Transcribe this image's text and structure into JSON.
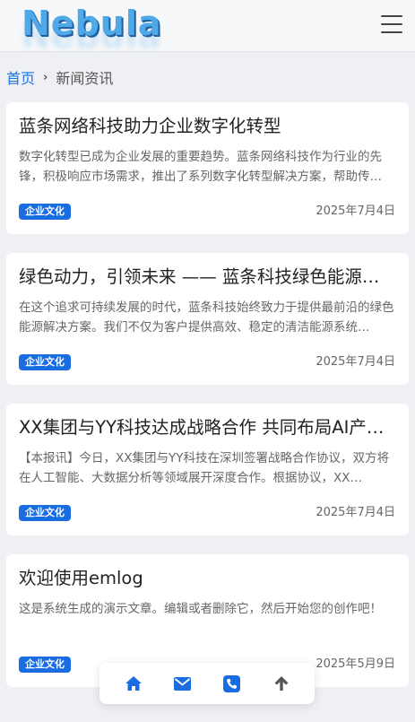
{
  "header": {
    "logo_text": "Nebula",
    "menu_icon": "hamburger-menu-icon"
  },
  "breadcrumb": {
    "home": "首页",
    "separator": "›",
    "current": "新闻资讯"
  },
  "articles": [
    {
      "title": "蓝条网络科技助力企业数字化转型",
      "excerpt": "数字化转型已成为企业发展的重要趋势。蓝条网络科技作为行业的先锋，积极响应市场需求，推出了系列数字化转型解决方案，帮助传…",
      "tag": "企业文化",
      "date": "2025年7月4日"
    },
    {
      "title": "绿色动力，引领未来 —— 蓝条科技绿色能源解决…",
      "excerpt": "在这个追求可持续发展的时代，蓝条科技始终致力于提供最前沿的绿色能源解决方案。我们不仅为客户提供高效、稳定的清洁能源系统…",
      "tag": "企业文化",
      "date": "2025年7月4日"
    },
    {
      "title": "XX集团与YY科技达成战略合作 共同布局AI产业…",
      "excerpt": "【本报讯】今日，XX集团与YY科技在深圳签署战略合作协议，双方将在人工智能、大数据分析等领域展开深度合作。根据协议，XX…",
      "tag": "企业文化",
      "date": "2025年7月4日"
    },
    {
      "title": "欢迎使用emlog",
      "excerpt": "这是系统生成的演示文章。编辑或者删除它，然后开始您的创作吧！",
      "tag": "企业文化",
      "date": "2025年5月9日"
    }
  ],
  "bottom_bar": {
    "buttons": [
      "home-icon",
      "mail-icon",
      "phone-icon",
      "arrow-up-icon"
    ]
  },
  "colors": {
    "accent": "#1a73e8",
    "tag_bg": "#1a6de0",
    "page_bg": "#eef0f3"
  }
}
